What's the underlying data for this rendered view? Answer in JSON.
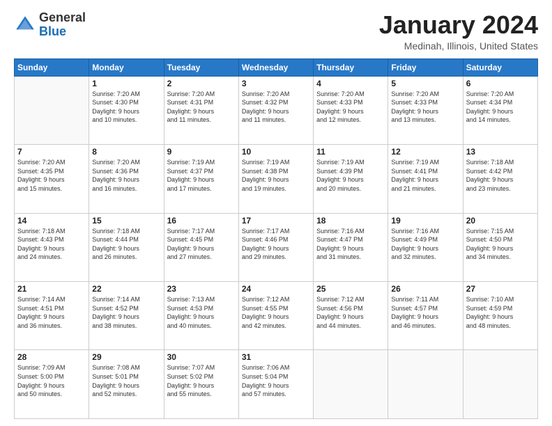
{
  "header": {
    "logo_general": "General",
    "logo_blue": "Blue",
    "month_title": "January 2024",
    "location": "Medinah, Illinois, United States"
  },
  "days_of_week": [
    "Sunday",
    "Monday",
    "Tuesday",
    "Wednesday",
    "Thursday",
    "Friday",
    "Saturday"
  ],
  "weeks": [
    [
      {
        "day": "",
        "info": ""
      },
      {
        "day": "1",
        "info": "Sunrise: 7:20 AM\nSunset: 4:30 PM\nDaylight: 9 hours\nand 10 minutes."
      },
      {
        "day": "2",
        "info": "Sunrise: 7:20 AM\nSunset: 4:31 PM\nDaylight: 9 hours\nand 11 minutes."
      },
      {
        "day": "3",
        "info": "Sunrise: 7:20 AM\nSunset: 4:32 PM\nDaylight: 9 hours\nand 11 minutes."
      },
      {
        "day": "4",
        "info": "Sunrise: 7:20 AM\nSunset: 4:33 PM\nDaylight: 9 hours\nand 12 minutes."
      },
      {
        "day": "5",
        "info": "Sunrise: 7:20 AM\nSunset: 4:33 PM\nDaylight: 9 hours\nand 13 minutes."
      },
      {
        "day": "6",
        "info": "Sunrise: 7:20 AM\nSunset: 4:34 PM\nDaylight: 9 hours\nand 14 minutes."
      }
    ],
    [
      {
        "day": "7",
        "info": "Sunrise: 7:20 AM\nSunset: 4:35 PM\nDaylight: 9 hours\nand 15 minutes."
      },
      {
        "day": "8",
        "info": "Sunrise: 7:20 AM\nSunset: 4:36 PM\nDaylight: 9 hours\nand 16 minutes."
      },
      {
        "day": "9",
        "info": "Sunrise: 7:19 AM\nSunset: 4:37 PM\nDaylight: 9 hours\nand 17 minutes."
      },
      {
        "day": "10",
        "info": "Sunrise: 7:19 AM\nSunset: 4:38 PM\nDaylight: 9 hours\nand 19 minutes."
      },
      {
        "day": "11",
        "info": "Sunrise: 7:19 AM\nSunset: 4:39 PM\nDaylight: 9 hours\nand 20 minutes."
      },
      {
        "day": "12",
        "info": "Sunrise: 7:19 AM\nSunset: 4:41 PM\nDaylight: 9 hours\nand 21 minutes."
      },
      {
        "day": "13",
        "info": "Sunrise: 7:18 AM\nSunset: 4:42 PM\nDaylight: 9 hours\nand 23 minutes."
      }
    ],
    [
      {
        "day": "14",
        "info": "Sunrise: 7:18 AM\nSunset: 4:43 PM\nDaylight: 9 hours\nand 24 minutes."
      },
      {
        "day": "15",
        "info": "Sunrise: 7:18 AM\nSunset: 4:44 PM\nDaylight: 9 hours\nand 26 minutes."
      },
      {
        "day": "16",
        "info": "Sunrise: 7:17 AM\nSunset: 4:45 PM\nDaylight: 9 hours\nand 27 minutes."
      },
      {
        "day": "17",
        "info": "Sunrise: 7:17 AM\nSunset: 4:46 PM\nDaylight: 9 hours\nand 29 minutes."
      },
      {
        "day": "18",
        "info": "Sunrise: 7:16 AM\nSunset: 4:47 PM\nDaylight: 9 hours\nand 31 minutes."
      },
      {
        "day": "19",
        "info": "Sunrise: 7:16 AM\nSunset: 4:49 PM\nDaylight: 9 hours\nand 32 minutes."
      },
      {
        "day": "20",
        "info": "Sunrise: 7:15 AM\nSunset: 4:50 PM\nDaylight: 9 hours\nand 34 minutes."
      }
    ],
    [
      {
        "day": "21",
        "info": "Sunrise: 7:14 AM\nSunset: 4:51 PM\nDaylight: 9 hours\nand 36 minutes."
      },
      {
        "day": "22",
        "info": "Sunrise: 7:14 AM\nSunset: 4:52 PM\nDaylight: 9 hours\nand 38 minutes."
      },
      {
        "day": "23",
        "info": "Sunrise: 7:13 AM\nSunset: 4:53 PM\nDaylight: 9 hours\nand 40 minutes."
      },
      {
        "day": "24",
        "info": "Sunrise: 7:12 AM\nSunset: 4:55 PM\nDaylight: 9 hours\nand 42 minutes."
      },
      {
        "day": "25",
        "info": "Sunrise: 7:12 AM\nSunset: 4:56 PM\nDaylight: 9 hours\nand 44 minutes."
      },
      {
        "day": "26",
        "info": "Sunrise: 7:11 AM\nSunset: 4:57 PM\nDaylight: 9 hours\nand 46 minutes."
      },
      {
        "day": "27",
        "info": "Sunrise: 7:10 AM\nSunset: 4:59 PM\nDaylight: 9 hours\nand 48 minutes."
      }
    ],
    [
      {
        "day": "28",
        "info": "Sunrise: 7:09 AM\nSunset: 5:00 PM\nDaylight: 9 hours\nand 50 minutes."
      },
      {
        "day": "29",
        "info": "Sunrise: 7:08 AM\nSunset: 5:01 PM\nDaylight: 9 hours\nand 52 minutes."
      },
      {
        "day": "30",
        "info": "Sunrise: 7:07 AM\nSunset: 5:02 PM\nDaylight: 9 hours\nand 55 minutes."
      },
      {
        "day": "31",
        "info": "Sunrise: 7:06 AM\nSunset: 5:04 PM\nDaylight: 9 hours\nand 57 minutes."
      },
      {
        "day": "",
        "info": ""
      },
      {
        "day": "",
        "info": ""
      },
      {
        "day": "",
        "info": ""
      }
    ]
  ]
}
